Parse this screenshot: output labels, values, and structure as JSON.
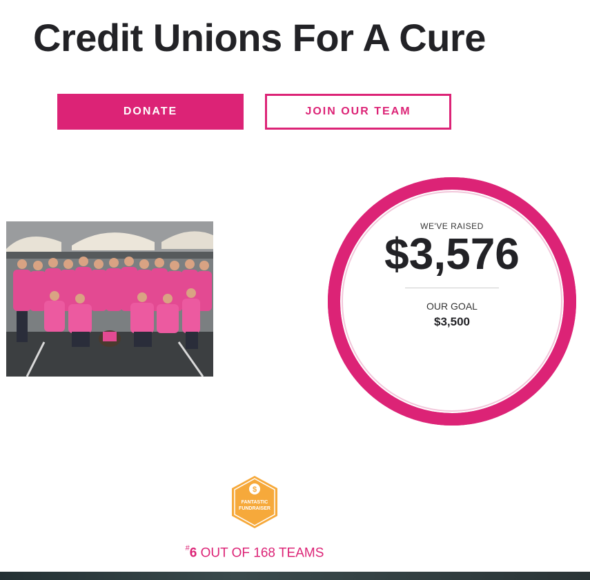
{
  "header": {
    "title": "Credit Unions For A Cure"
  },
  "actions": {
    "donate_label": "DONATE",
    "join_label": "JOIN OUR TEAM"
  },
  "photo": {
    "description_icon": "team-photo"
  },
  "progress": {
    "raised_label": "WE'VE RAISED",
    "raised_amount": "$3,576",
    "goal_label": "OUR GOAL",
    "goal_amount": "$3,500",
    "fraction": 1.0
  },
  "badge": {
    "icon": "dollar-coin-icon",
    "line1": "FANTASTIC",
    "line2": "FUNDRAISER"
  },
  "rank": {
    "hash": "#",
    "number": "6",
    "text": " OUT OF 168 TEAMS"
  },
  "colors": {
    "accent": "#dc2376",
    "dark_text": "#222226",
    "badge": "#f6a93b"
  }
}
